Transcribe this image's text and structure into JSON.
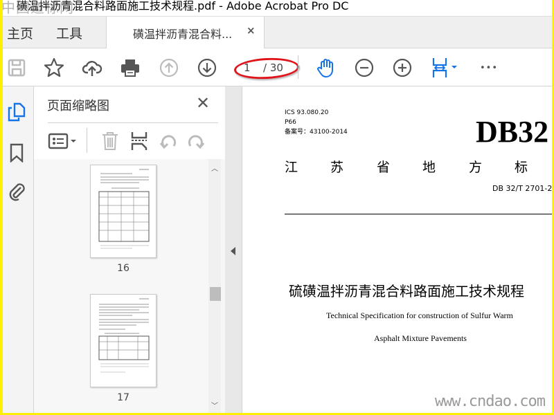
{
  "window": {
    "title": "磺温拌沥青混合料路面施工技术规程.pdf - Adobe Acrobat Pro DC",
    "watermark_top": "中国道标网",
    "watermark_bottom": "www.cndao.com"
  },
  "tabs": {
    "home": "主页",
    "tools": "工具",
    "document": "磺温拌沥青混合料...",
    "close": "×"
  },
  "toolbar": {
    "current_page": "1",
    "total_pages": "/ 30",
    "more": "•••"
  },
  "panel": {
    "title": "页面缩略图",
    "close": "✕",
    "thumbnails": [
      {
        "label": "16"
      },
      {
        "label": "17"
      }
    ]
  },
  "document": {
    "ics": "ICS  93.080.20",
    "class": "P66",
    "record": "备案号：43100-2014",
    "code_big": "DB32",
    "province": [
      "江",
      "苏",
      "省",
      "地",
      "方",
      "标"
    ],
    "std_no": "DB 32/T  2701-2",
    "title_cn": "硫磺温拌沥青混合料路面施工技术规程",
    "title_en_1": "Technical Specification for construction of Sulfur Warm",
    "title_en_2": "Asphalt Mixture Pavements"
  },
  "colors": {
    "accent": "#1473e6",
    "annotation": "#e0141a",
    "frame": "#ffef00"
  }
}
